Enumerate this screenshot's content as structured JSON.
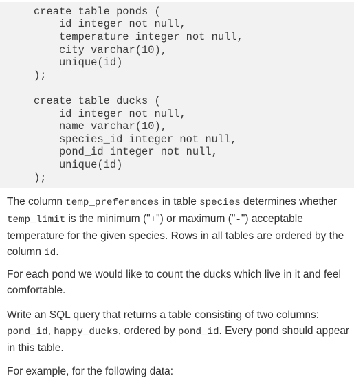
{
  "code": {
    "lines": [
      "create table ponds (",
      "    id integer not null,",
      "    temperature integer not null,",
      "    city varchar(10),",
      "    unique(id)",
      ");",
      "",
      "create table ducks (",
      "    id integer not null,",
      "    name varchar(10),",
      "    species_id integer not null,",
      "    pond_id integer not null,",
      "    unique(id)",
      ");"
    ]
  },
  "paragraphs": {
    "p1": {
      "t1": "The column ",
      "c1": "temp_preferences",
      "t2": " in table ",
      "c2": "species",
      "t3": " determines whether ",
      "c3": "temp_limit",
      "t4": " is the minimum (\"",
      "c4": "+",
      "t5": "\") or maximum (\"",
      "c5": "-",
      "t6": "\") acceptable temperature for the given species. Rows in all tables are ordered by the column ",
      "c6": "id",
      "t7": "."
    },
    "p2": "For each pond we would like to count the ducks which live in it and feel comfortable.",
    "p3": {
      "t1": "Write an SQL query that returns a table consisting of two columns: ",
      "c1": "pond_id",
      "t2": ", ",
      "c2": "happy_ducks",
      "t3": ", ordered by ",
      "c3": "pond_id",
      "t4": ". Every pond should appear in this table."
    },
    "p4": "For example, for the following data:"
  }
}
